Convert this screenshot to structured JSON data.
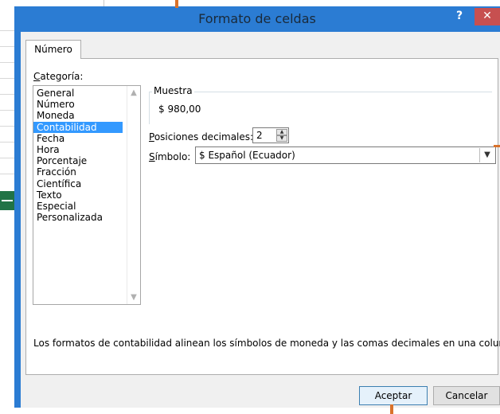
{
  "dialog": {
    "title": "Formato de celdas",
    "help_label": "?",
    "close_label": "✕"
  },
  "tabs": [
    {
      "label": "Número",
      "active": true
    }
  ],
  "category": {
    "label_prefix": "C",
    "label_rest": "ategoría:",
    "items": [
      "General",
      "Número",
      "Moneda",
      "Contabilidad",
      "Fecha",
      "Hora",
      "Porcentaje",
      "Fracción",
      "Científica",
      "Texto",
      "Especial",
      "Personalizada"
    ],
    "selected": "Contabilidad"
  },
  "sample": {
    "legend": "Muestra",
    "value": "$ 980,00"
  },
  "decimals": {
    "label_prefix": "P",
    "label_rest": "osiciones decimales:",
    "value": "2"
  },
  "symbol": {
    "label_prefix": "S",
    "label_rest": "ímbolo:",
    "value": "$ Español (Ecuador)"
  },
  "description": "Los formatos de contabilidad alinean los símbolos de moneda y las comas decimales en una columna.",
  "buttons": {
    "ok": "Aceptar",
    "cancel": "Cancelar"
  },
  "colors": {
    "titlebar": "#2b7cd3",
    "selection": "#3399ff",
    "close": "#c75050",
    "callout": "#d9722b"
  }
}
